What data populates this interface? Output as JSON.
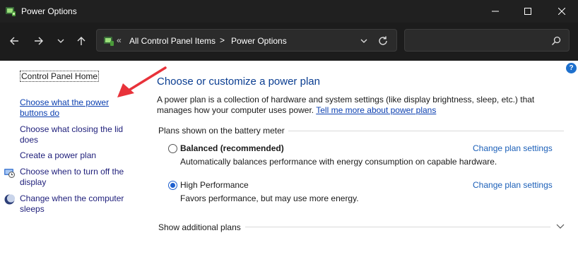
{
  "window": {
    "title": "Power Options"
  },
  "address": {
    "overflow_chevron": "«",
    "crumbs": [
      "All Control Panel Items",
      "Power Options"
    ],
    "separator": ">"
  },
  "search": {
    "placeholder": "",
    "value": ""
  },
  "help": {
    "label": "?"
  },
  "sidebar": {
    "home": "Control Panel Home",
    "links": [
      "Choose what the power buttons do",
      "Choose what closing the lid does",
      "Create a power plan",
      "Choose when to turn off the display",
      "Change when the computer sleeps"
    ]
  },
  "main": {
    "title": "Choose or customize a power plan",
    "description": "A power plan is a collection of hardware and system settings (like display brightness, sleep, etc.) that manages how your computer uses power.",
    "learn_more": "Tell me more about power plans",
    "group_header": "Plans shown on the battery meter",
    "plans": [
      {
        "name": "Balanced (recommended)",
        "description": "Automatically balances performance with energy consumption on capable hardware.",
        "settings_link": "Change plan settings",
        "selected": false
      },
      {
        "name": "High Performance",
        "description": "Favors performance, but may use more energy.",
        "settings_link": "Change plan settings",
        "selected": true
      }
    ],
    "additional_plans": "Show additional plans"
  },
  "colors": {
    "titlebar": "#202020",
    "link": "#0b3fb0",
    "heading": "#0a3d91",
    "annotation_arrow": "#e8323a"
  }
}
